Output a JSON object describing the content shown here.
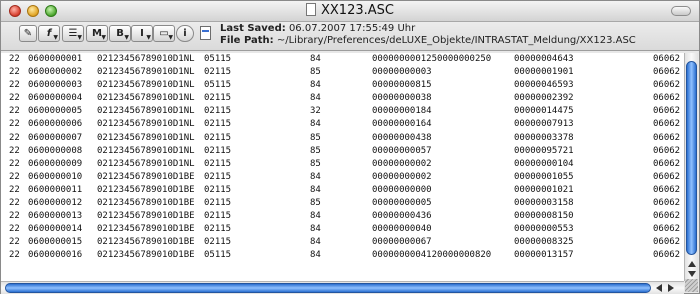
{
  "window": {
    "title": "XX123.ASC",
    "last_saved_label": "Last Saved:",
    "last_saved_value": "06.07.2007 17:55:49 Uhr",
    "file_path_label": "File Path:",
    "file_path_value": "~/Library/Preferences/deLUXE_Objekte/INTRASTAT_Meldung/XX123.ASC"
  },
  "toolbar": {
    "buttons": [
      {
        "name": "pencil-tool-button",
        "glyph": "✎"
      },
      {
        "name": "function-menu-button",
        "glyph": "f"
      },
      {
        "name": "list-menu-button",
        "glyph": "☰"
      },
      {
        "name": "mark-menu-button",
        "glyph": "M"
      },
      {
        "name": "bookmark-menu-button",
        "glyph": "B"
      },
      {
        "name": "text-tool-button",
        "glyph": "I"
      },
      {
        "name": "window-menu-button",
        "glyph": "▭"
      },
      {
        "name": "info-button",
        "glyph": "i"
      }
    ]
  },
  "rows": [
    [
      "22",
      "0600000001",
      "02123456789010D1NL",
      "05115",
      "84",
      "0000000001250000000250",
      "00000004643",
      "06062"
    ],
    [
      "22",
      "0600000002",
      "02123456789010D1NL",
      "02115",
      "85",
      "00000000003",
      "00000001901",
      "06062"
    ],
    [
      "22",
      "0600000003",
      "02123456789010D1NL",
      "05115",
      "84",
      "00000000815",
      "00000046593",
      "06062"
    ],
    [
      "22",
      "0600000004",
      "02123456789010D1NL",
      "02115",
      "84",
      "00000000038",
      "00000002392",
      "06062"
    ],
    [
      "22",
      "0600000005",
      "02123456789010D1NL",
      "02115",
      "32",
      "00000000184",
      "00000014475",
      "06062"
    ],
    [
      "22",
      "0600000006",
      "02123456789010D1NL",
      "02115",
      "84",
      "00000000164",
      "00000007913",
      "06062"
    ],
    [
      "22",
      "0600000007",
      "02123456789010D1NL",
      "02115",
      "85",
      "00000000438",
      "00000003378",
      "06062"
    ],
    [
      "22",
      "0600000008",
      "02123456789010D1NL",
      "02115",
      "85",
      "00000000057",
      "00000095721",
      "06062"
    ],
    [
      "22",
      "0600000009",
      "02123456789010D1NL",
      "02115",
      "85",
      "00000000002",
      "00000000104",
      "06062"
    ],
    [
      "22",
      "0600000010",
      "02123456789010D1BE",
      "02115",
      "84",
      "00000000002",
      "00000001055",
      "06062"
    ],
    [
      "22",
      "0600000011",
      "02123456789010D1BE",
      "02115",
      "84",
      "00000000000",
      "00000001021",
      "06062"
    ],
    [
      "22",
      "0600000012",
      "02123456789010D1BE",
      "02115",
      "85",
      "00000000005",
      "00000003158",
      "06062"
    ],
    [
      "22",
      "0600000013",
      "02123456789010D1BE",
      "02115",
      "84",
      "00000000436",
      "00000008150",
      "06062"
    ],
    [
      "22",
      "0600000014",
      "02123456789010D1BE",
      "02115",
      "84",
      "00000000040",
      "00000000553",
      "06062"
    ],
    [
      "22",
      "0600000015",
      "02123456789010D1BE",
      "02115",
      "84",
      "00000000067",
      "00000008325",
      "06062"
    ],
    [
      "22",
      "0600000016",
      "02123456789010D1BE",
      "05115",
      "84",
      "0000000004120000000820",
      "00000013157",
      "06062"
    ]
  ],
  "colors": {
    "scroll_thumb": "#2b6fd0",
    "close": "#d63b2a",
    "minimize": "#e0a321",
    "maximize": "#4aa52c"
  }
}
